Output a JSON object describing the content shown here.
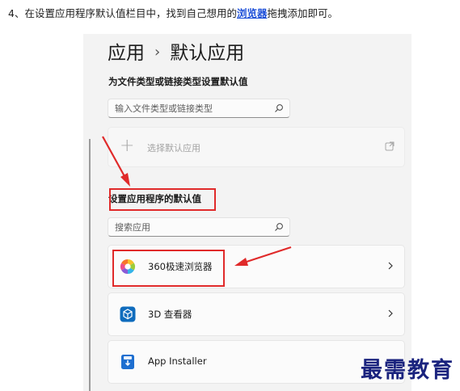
{
  "caption": {
    "prefix": "4、在设置应用程序默认值栏目中，找到自己想用的",
    "link": "浏览器",
    "suffix": "拖拽添加即可。"
  },
  "breadcrumb": {
    "parent": "应用",
    "separator": "›",
    "current": "默认应用"
  },
  "file_types": {
    "heading": "为文件类型或链接类型设置默认值",
    "search_placeholder": "输入文件类型或链接类型",
    "search_icon": "search-icon"
  },
  "choose_default": {
    "label": "选择默认应用",
    "icon": "plus-icon",
    "action_icon": "open-external-icon"
  },
  "apps_section": {
    "heading": "设置应用程序的默认值",
    "search_placeholder": "搜索应用",
    "items": [
      {
        "name": "360极速浏览器",
        "icon": "360-browser-icon"
      },
      {
        "name": "3D 查看器",
        "icon": "3d-viewer-icon"
      },
      {
        "name": "App Installer",
        "icon": "app-installer-icon"
      }
    ]
  },
  "annotation_color": "#e02a2a",
  "watermark": "最需教育"
}
